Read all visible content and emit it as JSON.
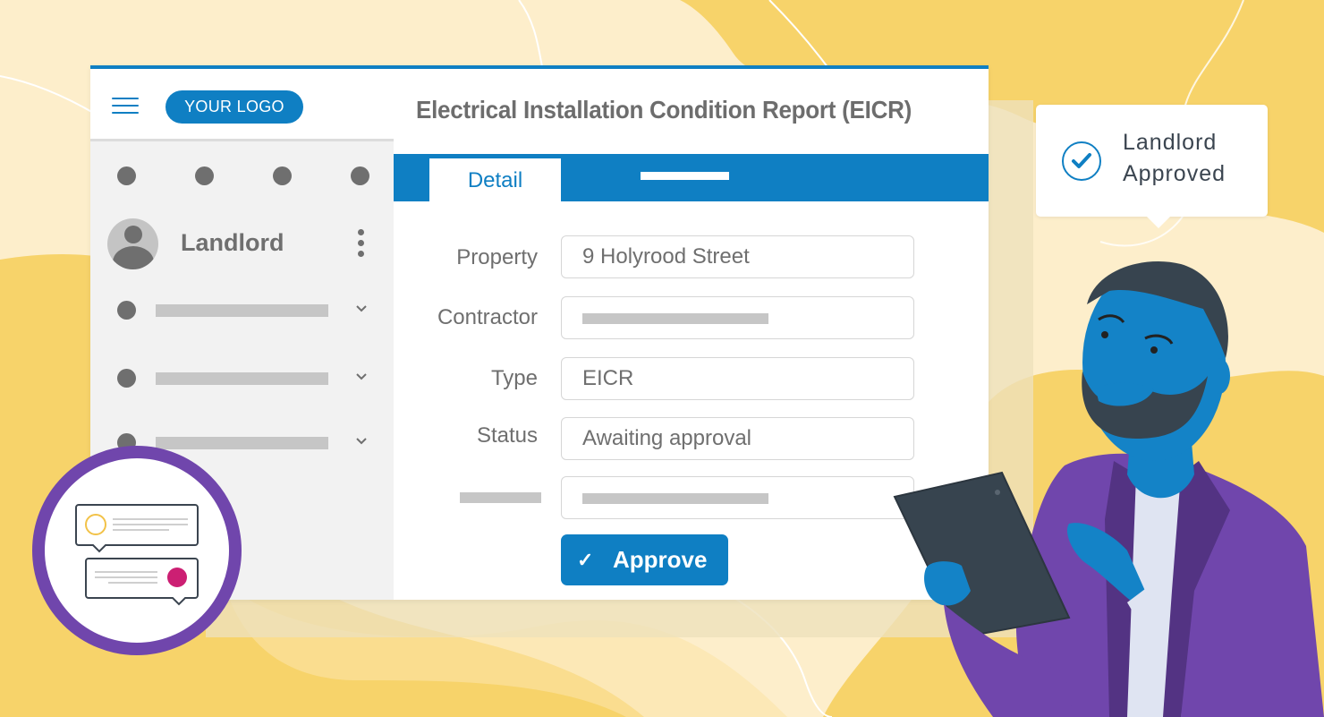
{
  "app": {
    "logo_label": "YOUR LOGO",
    "title": "Electrical Installation Condition Report (EICR)"
  },
  "sidebar": {
    "user": {
      "name": "Landlord"
    },
    "nav_items": [
      {
        "label": "",
        "expanded": false
      },
      {
        "label": "",
        "expanded": false
      },
      {
        "label": "",
        "expanded": false
      }
    ]
  },
  "tabs": [
    {
      "label": "Detail",
      "active": true
    },
    {
      "label": "",
      "active": false
    }
  ],
  "form": {
    "fields": [
      {
        "label": "Property",
        "value": "9 Holyrood Street"
      },
      {
        "label": "Contractor",
        "value": ""
      },
      {
        "label": "Type",
        "value": "EICR"
      },
      {
        "label": "Status",
        "value": "Awaiting approval"
      },
      {
        "label": "",
        "value": ""
      }
    ],
    "approve_label": "Approve"
  },
  "toast": {
    "line1": "Landlord",
    "line2": "Approved"
  },
  "colors": {
    "primary": "#0f7fc3",
    "accent_purple": "#7046ac",
    "accent_yellow": "#f7d36a",
    "background": "#fdeecb",
    "text_gray": "#6f6f6f",
    "notification_pink": "#cc1f73"
  }
}
